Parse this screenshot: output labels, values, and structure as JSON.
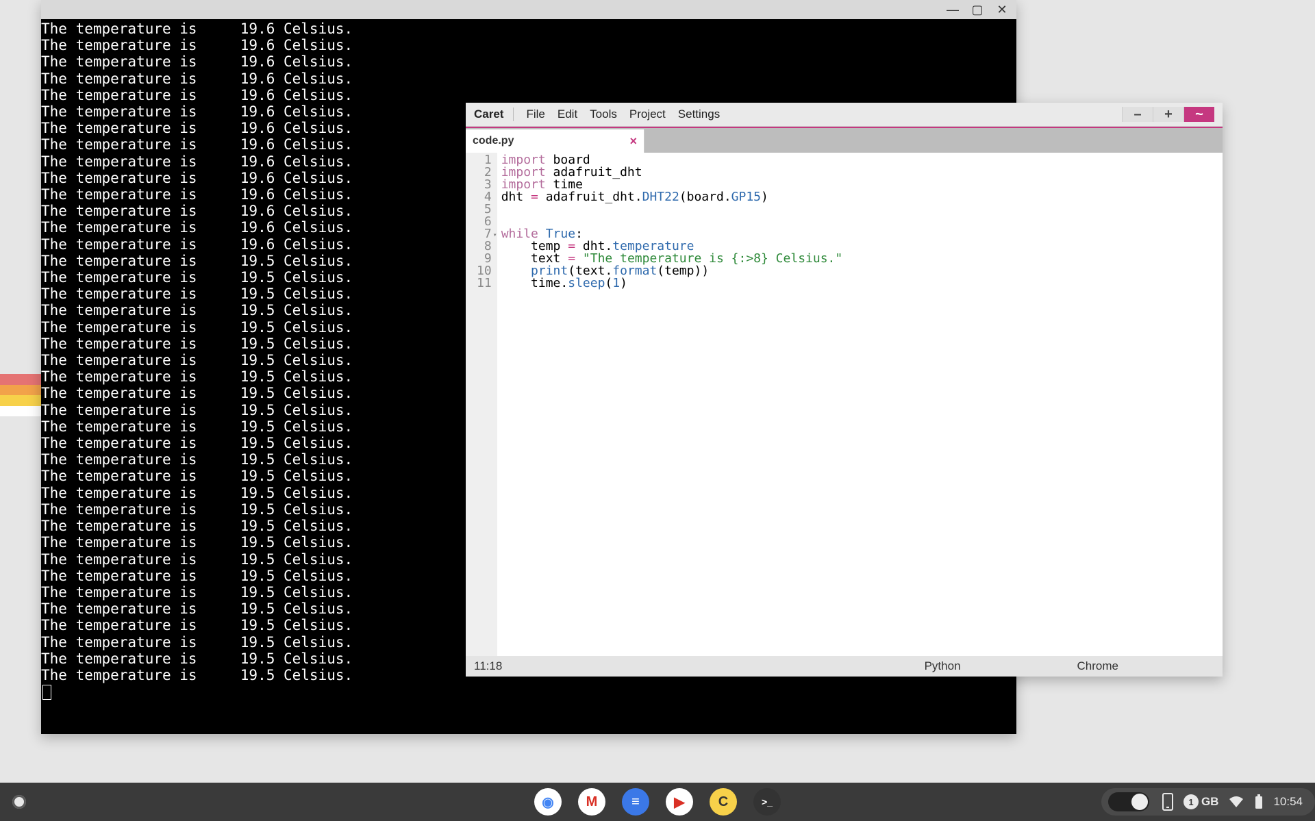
{
  "terminal": {
    "template": "The temperature is     {v} Celsius.",
    "readings": [
      "19.6",
      "19.6",
      "19.6",
      "19.6",
      "19.6",
      "19.6",
      "19.6",
      "19.6",
      "19.6",
      "19.6",
      "19.6",
      "19.6",
      "19.6",
      "19.6",
      "19.5",
      "19.5",
      "19.5",
      "19.5",
      "19.5",
      "19.5",
      "19.5",
      "19.5",
      "19.5",
      "19.5",
      "19.5",
      "19.5",
      "19.5",
      "19.5",
      "19.5",
      "19.5",
      "19.5",
      "19.5",
      "19.5",
      "19.5",
      "19.5",
      "19.5",
      "19.5",
      "19.5",
      "19.5",
      "19.5"
    ]
  },
  "editor": {
    "app_name": "Caret",
    "menus": [
      "File",
      "Edit",
      "Tools",
      "Project",
      "Settings"
    ],
    "window_buttons": {
      "minus": "–",
      "plus": "+",
      "tilde": "~"
    },
    "tab": {
      "label": "code.py",
      "close": "×"
    },
    "status": {
      "cursor": "11:18",
      "language": "Python",
      "platform": "Chrome"
    },
    "gutter_fold_line": 7,
    "code_lines": [
      [
        {
          "t": "import",
          "c": "kw"
        },
        {
          "t": " board"
        }
      ],
      [
        {
          "t": "import",
          "c": "kw"
        },
        {
          "t": " adafruit_dht"
        }
      ],
      [
        {
          "t": "import",
          "c": "kw"
        },
        {
          "t": " time"
        }
      ],
      [
        {
          "t": "dht "
        },
        {
          "t": "=",
          "c": "op"
        },
        {
          "t": " adafruit_dht."
        },
        {
          "t": "DHT22",
          "c": "fn"
        },
        {
          "t": "(board."
        },
        {
          "t": "GP15",
          "c": "fn"
        },
        {
          "t": ")"
        }
      ],
      [
        {
          "t": ""
        }
      ],
      [
        {
          "t": ""
        }
      ],
      [
        {
          "t": "while",
          "c": "kw"
        },
        {
          "t": " "
        },
        {
          "t": "True",
          "c": "builtin"
        },
        {
          "t": ":"
        }
      ],
      [
        {
          "t": "    temp "
        },
        {
          "t": "=",
          "c": "op"
        },
        {
          "t": " dht."
        },
        {
          "t": "temperature",
          "c": "fn"
        }
      ],
      [
        {
          "t": "    text "
        },
        {
          "t": "=",
          "c": "op"
        },
        {
          "t": " "
        },
        {
          "t": "\"The temperature is {:>8} Celsius.\"",
          "c": "str"
        }
      ],
      [
        {
          "t": "    "
        },
        {
          "t": "print",
          "c": "fn"
        },
        {
          "t": "(text."
        },
        {
          "t": "format",
          "c": "fn"
        },
        {
          "t": "(temp))"
        }
      ],
      [
        {
          "t": "    time."
        },
        {
          "t": "sleep",
          "c": "fn"
        },
        {
          "t": "("
        },
        {
          "t": "1",
          "c": "num"
        },
        {
          "t": ")"
        }
      ]
    ]
  },
  "shelf": {
    "storage": {
      "num": "1",
      "unit": "GB"
    },
    "clock": "10:54",
    "apps": [
      {
        "name": "chrome-app",
        "bg": "#fff",
        "glyph": "◉",
        "fg": "#4285f4"
      },
      {
        "name": "gmail-app",
        "bg": "#fff",
        "glyph": "M",
        "fg": "#d93025"
      },
      {
        "name": "docs-app",
        "bg": "#3b78e7",
        "glyph": "≡",
        "fg": "#fff"
      },
      {
        "name": "youtube-app",
        "bg": "#fff",
        "glyph": "▶",
        "fg": "#d93025"
      },
      {
        "name": "caret-app",
        "bg": "#f7d14a",
        "glyph": "C",
        "fg": "#333"
      },
      {
        "name": "terminal-app",
        "bg": "#333",
        "glyph": ">_",
        "fg": "#fff"
      }
    ]
  },
  "titlebar": {
    "min": "—",
    "max": "▢",
    "close": "✕"
  }
}
